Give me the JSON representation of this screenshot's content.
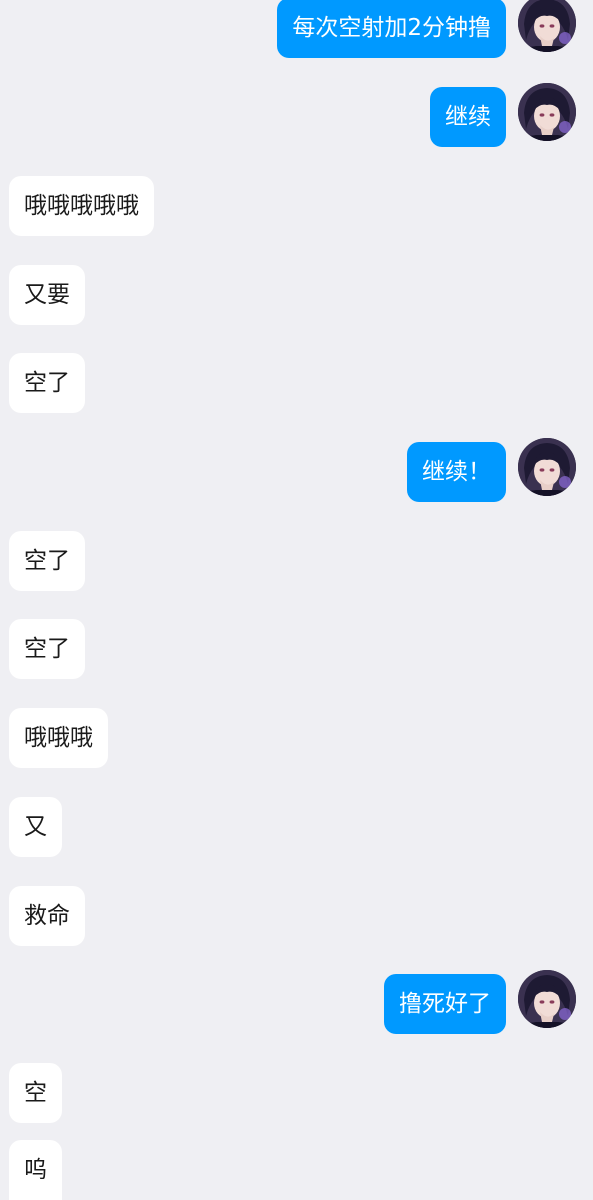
{
  "colors": {
    "background": "#efeff3",
    "incoming_bubble": "#ffffff",
    "outgoing_bubble": "#0099ff",
    "incoming_text": "#1a1a1a",
    "outgoing_text": "#ffffff"
  },
  "messages": [
    {
      "direction": "outgoing",
      "text": "每次空射加2分钟撸",
      "avatar": "contact-avatar-icon"
    },
    {
      "direction": "outgoing",
      "text": "继续",
      "avatar": "contact-avatar-icon"
    },
    {
      "direction": "incoming",
      "text": "哦哦哦哦哦"
    },
    {
      "direction": "incoming",
      "text": "又要"
    },
    {
      "direction": "incoming",
      "text": "空了"
    },
    {
      "direction": "outgoing",
      "text": "继续！",
      "avatar": "contact-avatar-icon"
    },
    {
      "direction": "incoming",
      "text": "空了"
    },
    {
      "direction": "incoming",
      "text": "空了"
    },
    {
      "direction": "incoming",
      "text": "哦哦哦"
    },
    {
      "direction": "incoming",
      "text": "又"
    },
    {
      "direction": "incoming",
      "text": "救命"
    },
    {
      "direction": "outgoing",
      "text": "撸死好了",
      "avatar": "contact-avatar-icon"
    },
    {
      "direction": "incoming",
      "text": "空"
    },
    {
      "direction": "incoming",
      "text": "呜"
    }
  ]
}
